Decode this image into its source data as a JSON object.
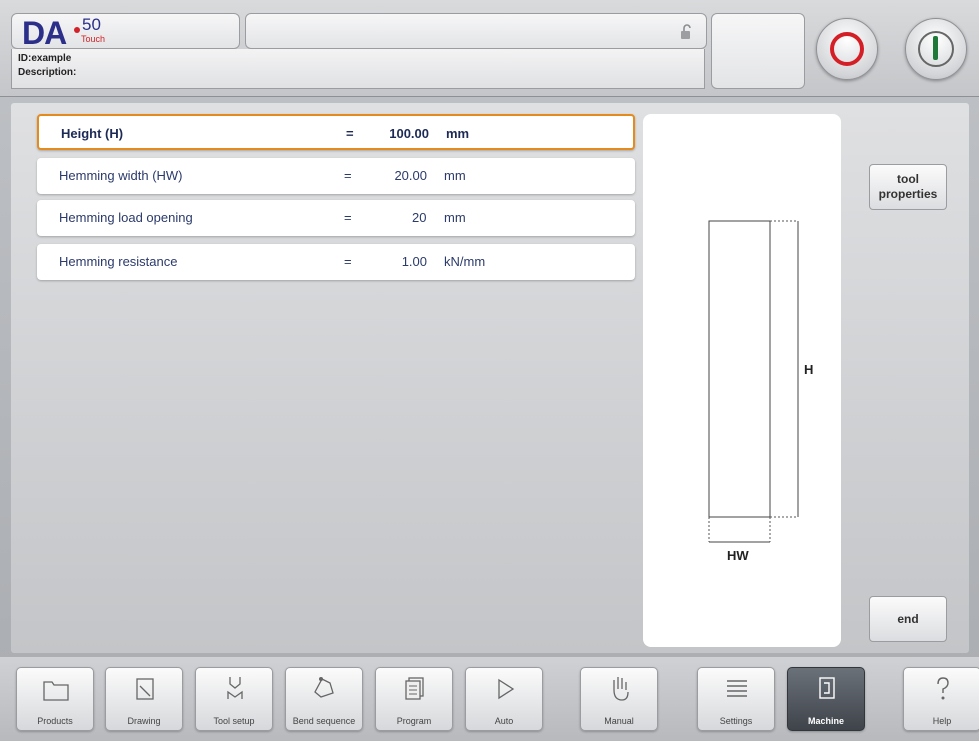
{
  "header": {
    "logo_brand": "DA",
    "logo_model": "50",
    "logo_sub": "Touch",
    "id_line": "ID:example",
    "description_line": "Description:"
  },
  "params": [
    {
      "label": "Height (H)",
      "eq": "=",
      "value": "100.00",
      "unit": "mm"
    },
    {
      "label": "Hemming width (HW)",
      "eq": "=",
      "value": "20.00",
      "unit": "mm"
    },
    {
      "label": "Hemming load opening",
      "eq": "=",
      "value": "20",
      "unit": "mm"
    },
    {
      "label": "Hemming resistance",
      "eq": "=",
      "value": "1.00",
      "unit": "kN/mm"
    }
  ],
  "drawing": {
    "h_label": "H",
    "hw_label": "HW"
  },
  "buttons": {
    "tool_properties": "tool properties",
    "end": "end"
  },
  "nav": [
    {
      "label": "Products",
      "icon": "folder-icon"
    },
    {
      "label": "Drawing",
      "icon": "pencil-icon"
    },
    {
      "label": "Tool setup",
      "icon": "punch-die-icon"
    },
    {
      "label": "Bend sequence",
      "icon": "bend-sequence-icon"
    },
    {
      "label": "Program",
      "icon": "pages-icon"
    },
    {
      "label": "Auto",
      "icon": "play-icon"
    },
    {
      "label": "Manual",
      "icon": "hand-icon"
    },
    {
      "label": "Settings",
      "icon": "list-icon"
    },
    {
      "label": "Machine",
      "icon": "machine-icon",
      "active": true
    },
    {
      "label": "Help",
      "icon": "question-icon"
    }
  ],
  "colors": {
    "selected_border": "#e58b1e",
    "stop_red": "#d51f26",
    "start_green": "#1f7a3a",
    "brand_blue": "#2b2f8a"
  }
}
